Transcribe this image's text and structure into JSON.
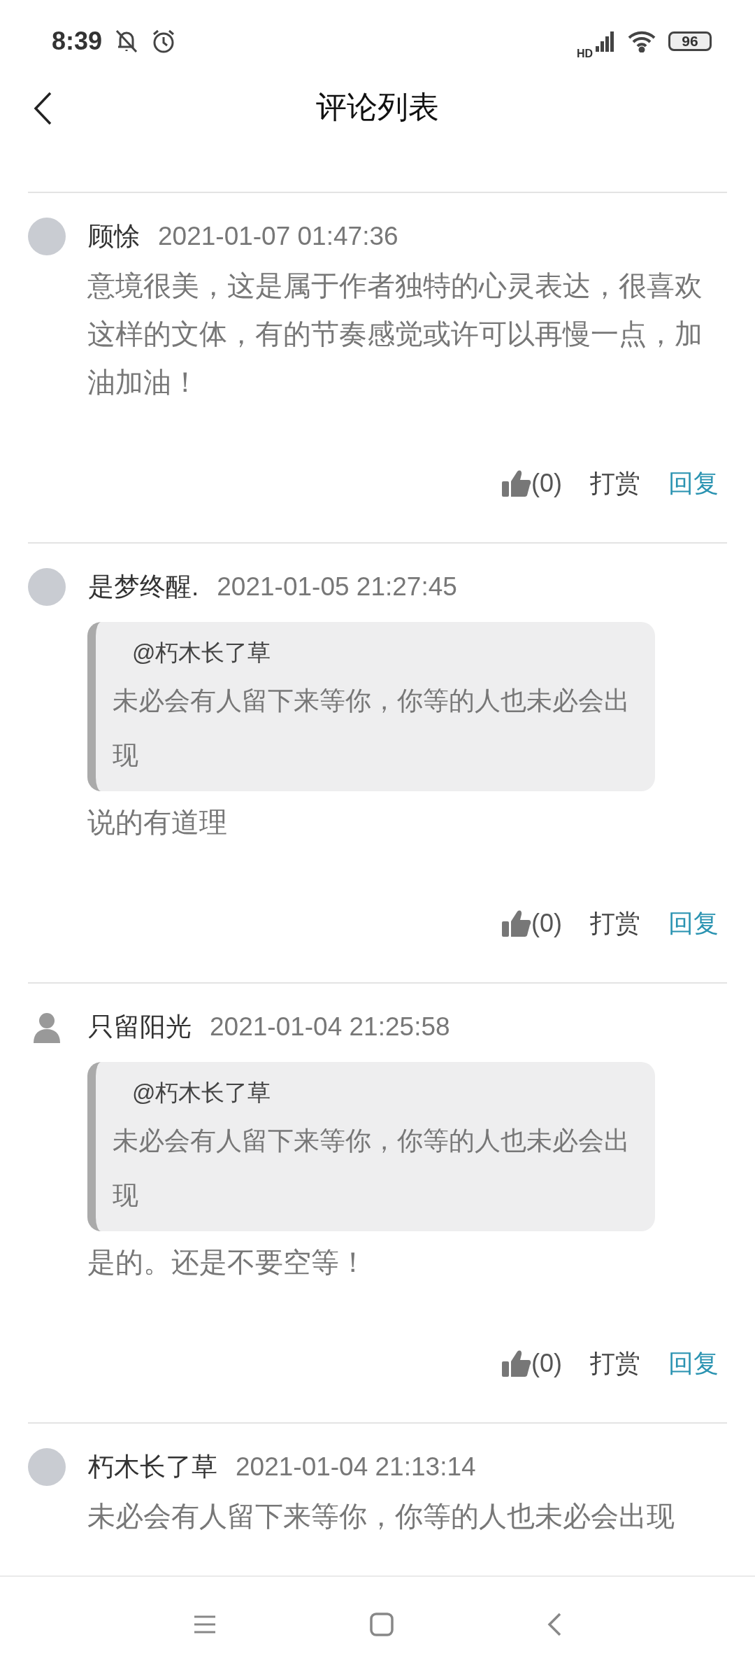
{
  "status_bar": {
    "time": "8:39",
    "network_label": "HD",
    "battery": "96"
  },
  "header": {
    "title": "评论列表"
  },
  "comments": [
    {
      "avatar": {
        "kind": "photo"
      },
      "name": "顾悇",
      "time": "2021-01-07 01:47:36",
      "text": "意境很美，这是属于作者独特的心灵表达，很喜欢这样的文体，有的节奏感觉或许可以再慢一点，加油加油！",
      "likes": "(0)",
      "reward": "打赏",
      "reply": "回复"
    },
    {
      "avatar": {
        "kind": "photo"
      },
      "name": "是梦终醒.",
      "time": "2021-01-05 21:27:45",
      "quote": {
        "mention": "@朽木长了草",
        "text": "未必会有人留下来等你，你等的人也未必会出现"
      },
      "text": "说的有道理",
      "likes": "(0)",
      "reward": "打赏",
      "reply": "回复"
    },
    {
      "avatar": {
        "kind": "silhouette"
      },
      "name": "只留阳光",
      "time": "2021-01-04 21:25:58",
      "quote": {
        "mention": "@朽木长了草",
        "text": "未必会有人留下来等你，你等的人也未必会出现"
      },
      "text": "是的。还是不要空等！",
      "likes": "(0)",
      "reward": "打赏",
      "reply": "回复"
    },
    {
      "avatar": {
        "kind": "photo"
      },
      "name": "朽木长了草",
      "time": "2021-01-04 21:13:14",
      "text": "未必会有人留下来等你，你等的人也未必会出现"
    }
  ]
}
